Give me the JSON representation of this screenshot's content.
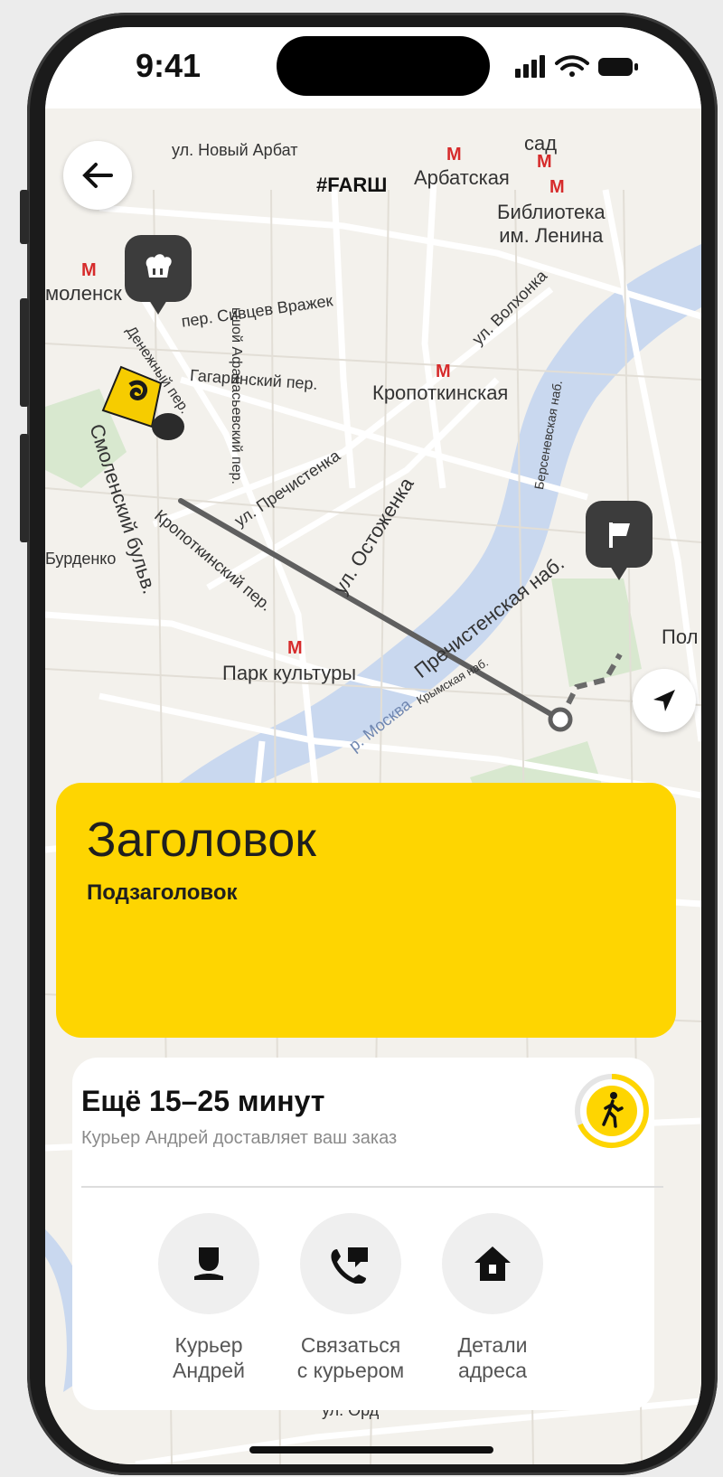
{
  "status_bar": {
    "time": "9:41"
  },
  "map": {
    "labels": {
      "novy_arbat": "ул. Новый Арбат",
      "farsh": "#FARШ",
      "arbatskaya": "Арбатская",
      "sad": "сад",
      "library": "Библиотека\nим. Ленина",
      "smolenskaya": "моленск",
      "sivtsev": "пер. Сивцев Вражек",
      "afanasevsky": "ьшой Афанасьевский пер.",
      "volkhonka": "ул. Волхонка",
      "gagarinsky": "Гагаринский пер.",
      "kropotkinskaya": "Кропоткинская",
      "denezhny": "Денежный пер.",
      "bersenevskaya": "Берсеневская наб.",
      "prechistenka": "ул. Пречистенка",
      "ostozhenka": "ул. Остоженка",
      "prechistenskaya": "Пречистенская наб.",
      "kropotkinsky_per": "Кропоткинский пер.",
      "smolensky_blvd": "Смоленский бульв.",
      "burdenko": "Бурденко",
      "park_kultury": "Парк культуры",
      "krymskaya": "Крымская наб.",
      "moskva": "р. Москва",
      "pol": "Пол",
      "ordynka": "ул. Орд"
    }
  },
  "banner": {
    "title": "Заголовок",
    "subtitle": "Подзаголовок"
  },
  "delivery": {
    "eta": "Ещё 15–25 минут",
    "subtitle": "Курьер Андрей доставляет ваш заказ",
    "actions": [
      {
        "label": "Курьер\nАндрей",
        "icon": "courier-icon"
      },
      {
        "label": "Связаться\nс курьером",
        "icon": "phone-icon"
      },
      {
        "label": "Детали\nадреса",
        "icon": "house-icon"
      }
    ]
  },
  "colors": {
    "accent_yellow": "#fed501",
    "route_gray": "#5f5f5f",
    "water": "#c9d8ef"
  }
}
